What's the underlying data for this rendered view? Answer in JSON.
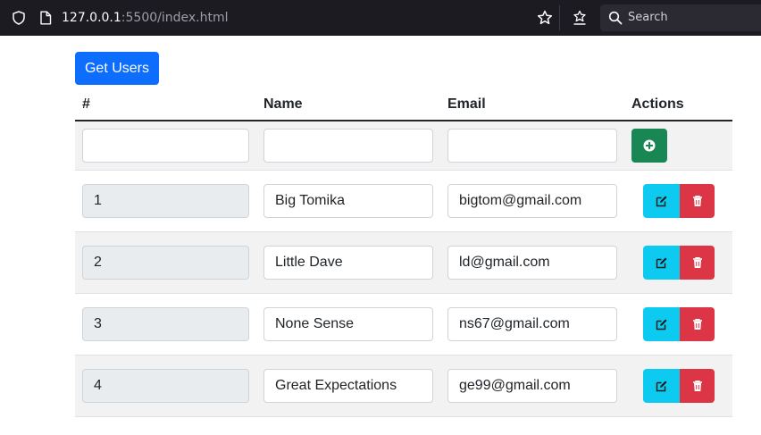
{
  "browser": {
    "url_host": "127.0.0.1",
    "url_rest": ":5500/index.html",
    "search_placeholder": "Search"
  },
  "page": {
    "get_users_label": "Get Users"
  },
  "table": {
    "headers": {
      "id": "#",
      "name": "Name",
      "email": "Email",
      "actions": "Actions"
    },
    "new_row": {
      "id": "",
      "name": "",
      "email": ""
    },
    "rows": [
      {
        "id": "1",
        "name": "Big Tomika",
        "email": "bigtom@gmail.com"
      },
      {
        "id": "2",
        "name": "Little Dave",
        "email": "ld@gmail.com"
      },
      {
        "id": "3",
        "name": "None Sense",
        "email": "ns67@gmail.com"
      },
      {
        "id": "4",
        "name": "Great Expectations",
        "email": "ge99@gmail.com"
      }
    ]
  },
  "icons": {
    "add": "plus-circle-icon",
    "edit": "edit-icon",
    "delete": "trash-icon"
  },
  "colors": {
    "primary": "#0d6efd",
    "success": "#198754",
    "info": "#0dcaf0",
    "danger": "#dc3545"
  }
}
